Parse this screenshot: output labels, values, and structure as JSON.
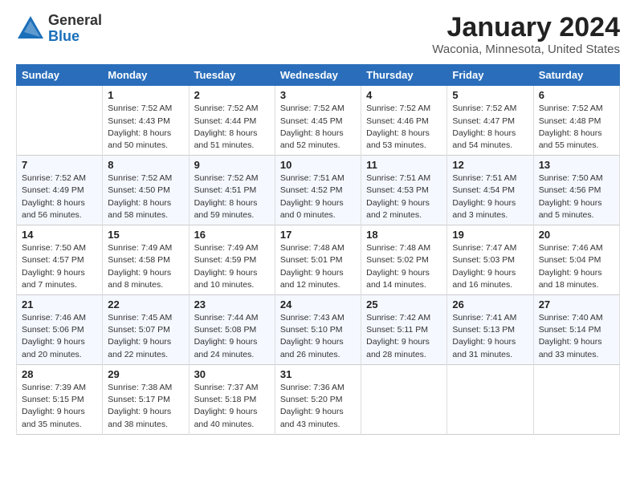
{
  "logo": {
    "general": "General",
    "blue": "Blue"
  },
  "title": "January 2024",
  "subtitle": "Waconia, Minnesota, United States",
  "headers": [
    "Sunday",
    "Monday",
    "Tuesday",
    "Wednesday",
    "Thursday",
    "Friday",
    "Saturday"
  ],
  "weeks": [
    [
      {
        "day": "",
        "info": ""
      },
      {
        "day": "1",
        "info": "Sunrise: 7:52 AM\nSunset: 4:43 PM\nDaylight: 8 hours\nand 50 minutes."
      },
      {
        "day": "2",
        "info": "Sunrise: 7:52 AM\nSunset: 4:44 PM\nDaylight: 8 hours\nand 51 minutes."
      },
      {
        "day": "3",
        "info": "Sunrise: 7:52 AM\nSunset: 4:45 PM\nDaylight: 8 hours\nand 52 minutes."
      },
      {
        "day": "4",
        "info": "Sunrise: 7:52 AM\nSunset: 4:46 PM\nDaylight: 8 hours\nand 53 minutes."
      },
      {
        "day": "5",
        "info": "Sunrise: 7:52 AM\nSunset: 4:47 PM\nDaylight: 8 hours\nand 54 minutes."
      },
      {
        "day": "6",
        "info": "Sunrise: 7:52 AM\nSunset: 4:48 PM\nDaylight: 8 hours\nand 55 minutes."
      }
    ],
    [
      {
        "day": "7",
        "info": "Sunrise: 7:52 AM\nSunset: 4:49 PM\nDaylight: 8 hours\nand 56 minutes."
      },
      {
        "day": "8",
        "info": "Sunrise: 7:52 AM\nSunset: 4:50 PM\nDaylight: 8 hours\nand 58 minutes."
      },
      {
        "day": "9",
        "info": "Sunrise: 7:52 AM\nSunset: 4:51 PM\nDaylight: 8 hours\nand 59 minutes."
      },
      {
        "day": "10",
        "info": "Sunrise: 7:51 AM\nSunset: 4:52 PM\nDaylight: 9 hours\nand 0 minutes."
      },
      {
        "day": "11",
        "info": "Sunrise: 7:51 AM\nSunset: 4:53 PM\nDaylight: 9 hours\nand 2 minutes."
      },
      {
        "day": "12",
        "info": "Sunrise: 7:51 AM\nSunset: 4:54 PM\nDaylight: 9 hours\nand 3 minutes."
      },
      {
        "day": "13",
        "info": "Sunrise: 7:50 AM\nSunset: 4:56 PM\nDaylight: 9 hours\nand 5 minutes."
      }
    ],
    [
      {
        "day": "14",
        "info": "Sunrise: 7:50 AM\nSunset: 4:57 PM\nDaylight: 9 hours\nand 7 minutes."
      },
      {
        "day": "15",
        "info": "Sunrise: 7:49 AM\nSunset: 4:58 PM\nDaylight: 9 hours\nand 8 minutes."
      },
      {
        "day": "16",
        "info": "Sunrise: 7:49 AM\nSunset: 4:59 PM\nDaylight: 9 hours\nand 10 minutes."
      },
      {
        "day": "17",
        "info": "Sunrise: 7:48 AM\nSunset: 5:01 PM\nDaylight: 9 hours\nand 12 minutes."
      },
      {
        "day": "18",
        "info": "Sunrise: 7:48 AM\nSunset: 5:02 PM\nDaylight: 9 hours\nand 14 minutes."
      },
      {
        "day": "19",
        "info": "Sunrise: 7:47 AM\nSunset: 5:03 PM\nDaylight: 9 hours\nand 16 minutes."
      },
      {
        "day": "20",
        "info": "Sunrise: 7:46 AM\nSunset: 5:04 PM\nDaylight: 9 hours\nand 18 minutes."
      }
    ],
    [
      {
        "day": "21",
        "info": "Sunrise: 7:46 AM\nSunset: 5:06 PM\nDaylight: 9 hours\nand 20 minutes."
      },
      {
        "day": "22",
        "info": "Sunrise: 7:45 AM\nSunset: 5:07 PM\nDaylight: 9 hours\nand 22 minutes."
      },
      {
        "day": "23",
        "info": "Sunrise: 7:44 AM\nSunset: 5:08 PM\nDaylight: 9 hours\nand 24 minutes."
      },
      {
        "day": "24",
        "info": "Sunrise: 7:43 AM\nSunset: 5:10 PM\nDaylight: 9 hours\nand 26 minutes."
      },
      {
        "day": "25",
        "info": "Sunrise: 7:42 AM\nSunset: 5:11 PM\nDaylight: 9 hours\nand 28 minutes."
      },
      {
        "day": "26",
        "info": "Sunrise: 7:41 AM\nSunset: 5:13 PM\nDaylight: 9 hours\nand 31 minutes."
      },
      {
        "day": "27",
        "info": "Sunrise: 7:40 AM\nSunset: 5:14 PM\nDaylight: 9 hours\nand 33 minutes."
      }
    ],
    [
      {
        "day": "28",
        "info": "Sunrise: 7:39 AM\nSunset: 5:15 PM\nDaylight: 9 hours\nand 35 minutes."
      },
      {
        "day": "29",
        "info": "Sunrise: 7:38 AM\nSunset: 5:17 PM\nDaylight: 9 hours\nand 38 minutes."
      },
      {
        "day": "30",
        "info": "Sunrise: 7:37 AM\nSunset: 5:18 PM\nDaylight: 9 hours\nand 40 minutes."
      },
      {
        "day": "31",
        "info": "Sunrise: 7:36 AM\nSunset: 5:20 PM\nDaylight: 9 hours\nand 43 minutes."
      },
      {
        "day": "",
        "info": ""
      },
      {
        "day": "",
        "info": ""
      },
      {
        "day": "",
        "info": ""
      }
    ]
  ]
}
